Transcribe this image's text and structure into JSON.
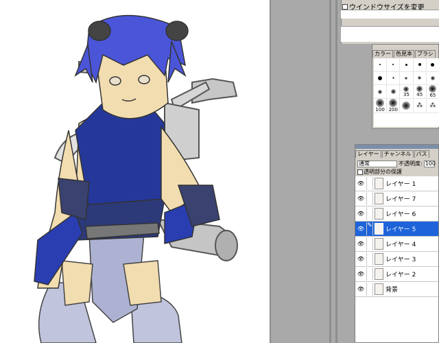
{
  "window_size_panel": {
    "checkbox_label": "ウインドウサイズを変更"
  },
  "brush_panel": {
    "tabs": [
      "カラー",
      "色見本",
      "ブラシ"
    ],
    "brushes": [
      {
        "size": 1,
        "label": ""
      },
      {
        "size": 3,
        "label": ""
      },
      {
        "size": 5,
        "label": ""
      },
      {
        "size": 9,
        "label": ""
      },
      {
        "size": 13,
        "label": ""
      },
      {
        "size": 19,
        "label": ""
      },
      {
        "size": 5,
        "label": ""
      },
      {
        "size": 9,
        "label": ""
      },
      {
        "size": 13,
        "label": ""
      },
      {
        "size": 17,
        "label": ""
      },
      {
        "size": 21,
        "label": ""
      },
      {
        "size": 27,
        "label": ""
      },
      {
        "size": 35,
        "label": "35"
      },
      {
        "size": 45,
        "label": "45"
      },
      {
        "size": 65,
        "label": "65"
      },
      {
        "size": 100,
        "label": "100"
      },
      {
        "size": 200,
        "label": "200"
      },
      {
        "size": 300,
        "label": ""
      },
      {
        "size": 0,
        "label": ""
      },
      {
        "size": 0,
        "label": ""
      }
    ]
  },
  "layers_panel": {
    "tabs": [
      "レイヤー",
      "チャンネル",
      "パス"
    ],
    "blend_mode": "通常",
    "opacity_label": "不透明度:",
    "opacity_value": "100",
    "preserve_label": "透明部分の保護",
    "layers": [
      {
        "name": "レイヤー 1",
        "active": false
      },
      {
        "name": "レイヤー 7",
        "active": false
      },
      {
        "name": "レイヤー 6",
        "active": false
      },
      {
        "name": "レイヤー 5",
        "active": true
      },
      {
        "name": "レイヤー 4",
        "active": false
      },
      {
        "name": "レイヤー 3",
        "active": false
      },
      {
        "name": "レイヤー 2",
        "active": false
      },
      {
        "name": "背景",
        "active": false
      }
    ]
  },
  "colors": {
    "hair": "#4a55d8",
    "outfit": "#25389a",
    "skin": "#f2ddb0",
    "grey_cloth": "#b8bcd8",
    "active_layer": "#1e63d9"
  }
}
